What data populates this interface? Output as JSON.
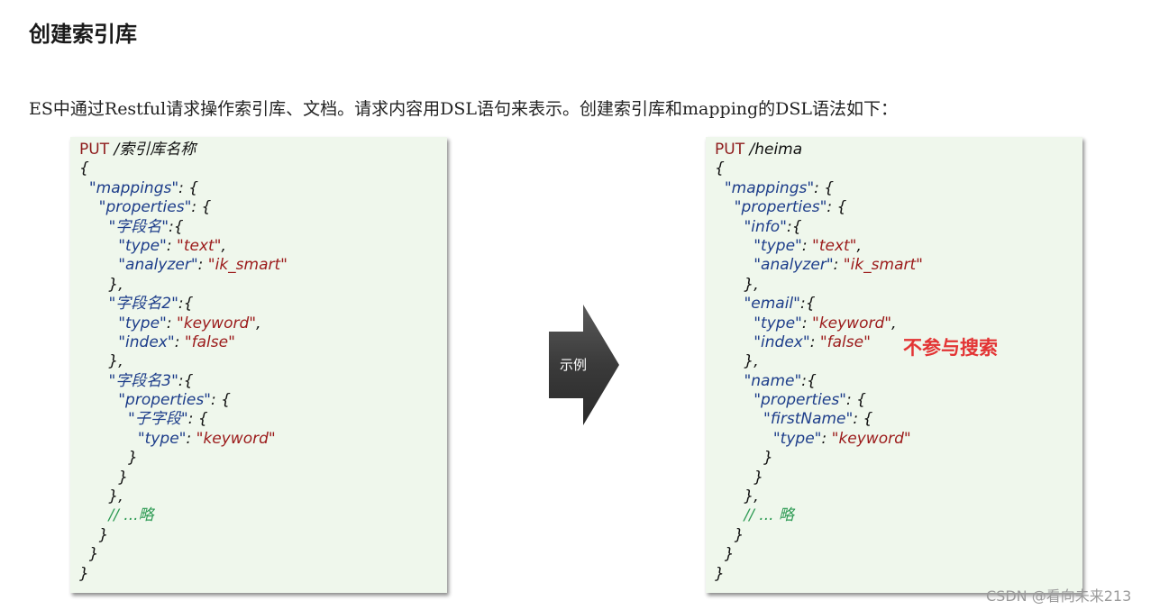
{
  "page": {
    "title": "创建索引库",
    "intro": "ES中通过Restful请求操作索引库、文档。请求内容用DSL语句来表示。创建索引库和mapping的DSL语法如下："
  },
  "left_code": {
    "method": "PUT",
    "path": " /索引库名称",
    "lines": [
      [
        {
          "t": "{",
          "c": "blk"
        }
      ],
      [
        {
          "t": "  ",
          "c": "blk"
        },
        {
          "t": "\"mappings\"",
          "c": "key"
        },
        {
          "t": ": {",
          "c": "blk"
        }
      ],
      [
        {
          "t": "    ",
          "c": "blk"
        },
        {
          "t": "\"properties\"",
          "c": "key"
        },
        {
          "t": ": {",
          "c": "blk"
        }
      ],
      [
        {
          "t": "      ",
          "c": "blk"
        },
        {
          "t": "\"字段名\"",
          "c": "key"
        },
        {
          "t": ":{",
          "c": "blk"
        }
      ],
      [
        {
          "t": "        ",
          "c": "blk"
        },
        {
          "t": "\"type\"",
          "c": "key"
        },
        {
          "t": ": ",
          "c": "blk"
        },
        {
          "t": "\"text\"",
          "c": "str"
        },
        {
          "t": ",",
          "c": "blk"
        }
      ],
      [
        {
          "t": "        ",
          "c": "blk"
        },
        {
          "t": "\"analyzer\"",
          "c": "key"
        },
        {
          "t": ": ",
          "c": "blk"
        },
        {
          "t": "\"ik_smart\"",
          "c": "str"
        }
      ],
      [
        {
          "t": "      },",
          "c": "blk"
        }
      ],
      [
        {
          "t": "      ",
          "c": "blk"
        },
        {
          "t": "\"字段名2\"",
          "c": "key"
        },
        {
          "t": ":{",
          "c": "blk"
        }
      ],
      [
        {
          "t": "        ",
          "c": "blk"
        },
        {
          "t": "\"type\"",
          "c": "key"
        },
        {
          "t": ": ",
          "c": "blk"
        },
        {
          "t": "\"keyword\"",
          "c": "str"
        },
        {
          "t": ",",
          "c": "blk"
        }
      ],
      [
        {
          "t": "        ",
          "c": "blk"
        },
        {
          "t": "\"index\"",
          "c": "key"
        },
        {
          "t": ": ",
          "c": "blk"
        },
        {
          "t": "\"false\"",
          "c": "str"
        }
      ],
      [
        {
          "t": "      },",
          "c": "blk"
        }
      ],
      [
        {
          "t": "      ",
          "c": "blk"
        },
        {
          "t": "\"字段名3\"",
          "c": "key"
        },
        {
          "t": ":{",
          "c": "blk"
        }
      ],
      [
        {
          "t": "        ",
          "c": "blk"
        },
        {
          "t": "\"properties\"",
          "c": "key"
        },
        {
          "t": ": {",
          "c": "blk"
        }
      ],
      [
        {
          "t": "          ",
          "c": "blk"
        },
        {
          "t": "\"子字段\"",
          "c": "key"
        },
        {
          "t": ": {",
          "c": "blk"
        }
      ],
      [
        {
          "t": "            ",
          "c": "blk"
        },
        {
          "t": "\"type\"",
          "c": "key"
        },
        {
          "t": ": ",
          "c": "blk"
        },
        {
          "t": "\"keyword\"",
          "c": "str"
        }
      ],
      [
        {
          "t": "          }",
          "c": "blk"
        }
      ],
      [
        {
          "t": "        }",
          "c": "blk"
        }
      ],
      [
        {
          "t": "      },",
          "c": "blk"
        }
      ],
      [
        {
          "t": "      ",
          "c": "blk"
        },
        {
          "t": "// ...略",
          "c": "cmt"
        }
      ],
      [
        {
          "t": "    }",
          "c": "blk"
        }
      ],
      [
        {
          "t": "  }",
          "c": "blk"
        }
      ],
      [
        {
          "t": "}",
          "c": "blk"
        }
      ]
    ]
  },
  "arrow": {
    "label": "示例",
    "color": "#444444"
  },
  "right_code": {
    "method": "PUT",
    "path": " /heima",
    "lines": [
      [
        {
          "t": "{",
          "c": "blk"
        }
      ],
      [
        {
          "t": "  ",
          "c": "blk"
        },
        {
          "t": "\"mappings\"",
          "c": "key"
        },
        {
          "t": ": {",
          "c": "blk"
        }
      ],
      [
        {
          "t": "    ",
          "c": "blk"
        },
        {
          "t": "\"properties\"",
          "c": "key"
        },
        {
          "t": ": {",
          "c": "blk"
        }
      ],
      [
        {
          "t": "      ",
          "c": "blk"
        },
        {
          "t": "\"info\"",
          "c": "key"
        },
        {
          "t": ":{",
          "c": "blk"
        }
      ],
      [
        {
          "t": "        ",
          "c": "blk"
        },
        {
          "t": "\"type\"",
          "c": "key"
        },
        {
          "t": ": ",
          "c": "blk"
        },
        {
          "t": "\"text\"",
          "c": "str"
        },
        {
          "t": ",",
          "c": "blk"
        }
      ],
      [
        {
          "t": "        ",
          "c": "blk"
        },
        {
          "t": "\"analyzer\"",
          "c": "key"
        },
        {
          "t": ": ",
          "c": "blk"
        },
        {
          "t": "\"ik_smart\"",
          "c": "str"
        }
      ],
      [
        {
          "t": "      },",
          "c": "blk"
        }
      ],
      [
        {
          "t": "      ",
          "c": "blk"
        },
        {
          "t": "\"email\"",
          "c": "key"
        },
        {
          "t": ":{",
          "c": "blk"
        }
      ],
      [
        {
          "t": "        ",
          "c": "blk"
        },
        {
          "t": "\"type\"",
          "c": "key"
        },
        {
          "t": ": ",
          "c": "blk"
        },
        {
          "t": "\"keyword\"",
          "c": "str"
        },
        {
          "t": ",",
          "c": "blk"
        }
      ],
      [
        {
          "t": "        ",
          "c": "blk"
        },
        {
          "t": "\"index\"",
          "c": "key"
        },
        {
          "t": ": ",
          "c": "blk"
        },
        {
          "t": "\"false\"",
          "c": "str"
        }
      ],
      [
        {
          "t": "      },",
          "c": "blk"
        }
      ],
      [
        {
          "t": "      ",
          "c": "blk"
        },
        {
          "t": "\"name\"",
          "c": "key"
        },
        {
          "t": ":{",
          "c": "blk"
        }
      ],
      [
        {
          "t": "        ",
          "c": "blk"
        },
        {
          "t": "\"properties\"",
          "c": "key"
        },
        {
          "t": ": {",
          "c": "blk"
        }
      ],
      [
        {
          "t": "          ",
          "c": "blk"
        },
        {
          "t": "\"firstName\"",
          "c": "key"
        },
        {
          "t": ": {",
          "c": "blk"
        }
      ],
      [
        {
          "t": "            ",
          "c": "blk"
        },
        {
          "t": "\"type\"",
          "c": "key"
        },
        {
          "t": ": ",
          "c": "blk"
        },
        {
          "t": "\"keyword\"",
          "c": "str"
        }
      ],
      [
        {
          "t": "          }",
          "c": "blk"
        }
      ],
      [
        {
          "t": "        }",
          "c": "blk"
        }
      ],
      [
        {
          "t": "      },",
          "c": "blk"
        }
      ],
      [
        {
          "t": "      ",
          "c": "blk"
        },
        {
          "t": "// ... 略",
          "c": "cmt"
        }
      ],
      [
        {
          "t": "    }",
          "c": "blk"
        }
      ],
      [
        {
          "t": "  }",
          "c": "blk"
        }
      ],
      [
        {
          "t": "}",
          "c": "blk"
        }
      ]
    ],
    "note": "不参与搜索"
  },
  "watermark": "CSDN @看向未来213"
}
